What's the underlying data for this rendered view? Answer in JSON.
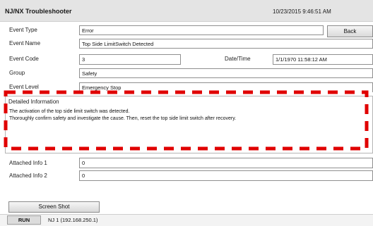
{
  "header": {
    "title": "NJ/NX Troubleshooter",
    "datetime": "10/23/2015 9:46:51 AM"
  },
  "buttons": {
    "back": "Back",
    "screenshot": "Screen Shot"
  },
  "fields": {
    "event_type": {
      "label": "Event Type",
      "value": "Error"
    },
    "event_name": {
      "label": "Event Name",
      "value": "Top Side LimitSwitch Detected"
    },
    "event_code": {
      "label": "Event Code",
      "value": "3"
    },
    "date_time": {
      "label": "Date/Time",
      "value": "1/1/1970 11:58:12 AM"
    },
    "group": {
      "label": "Group",
      "value": "Safety"
    },
    "event_level": {
      "label": "Event Level",
      "value": "Emergency Stop"
    },
    "attached_info_1": {
      "label": "Attached Info 1",
      "value": "0"
    },
    "attached_info_2": {
      "label": "Attached Info 2",
      "value": "0"
    }
  },
  "detail": {
    "title": "Detailed Information",
    "lines": [
      "The activation of the top side limit switch was detected.",
      "Thoroughly confirm safety and investigate the cause. Then, reset the top side limit switch after recovery."
    ]
  },
  "status": {
    "mode": "RUN",
    "connection": "NJ 1 (192.168.250.1)"
  },
  "colors": {
    "highlight": "#e00000",
    "titlebar": "#e4e4e4"
  }
}
